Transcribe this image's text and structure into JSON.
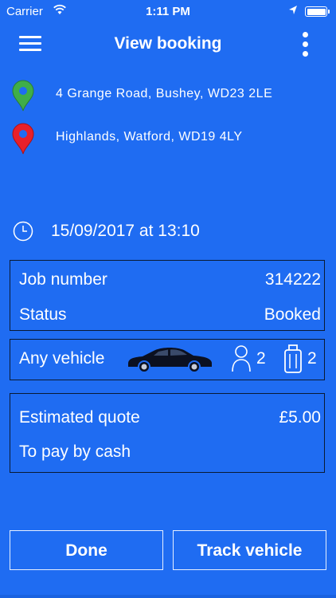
{
  "status_bar": {
    "carrier": "Carrier",
    "time": "1:11 PM",
    "wifi_icon": "wifi-icon",
    "location_icon": "location-arrow-icon",
    "battery_icon": "battery-icon"
  },
  "nav": {
    "title": "View booking",
    "menu_icon": "hamburger-menu-icon",
    "more_icon": "more-vertical-icon"
  },
  "pickup": {
    "address": "4 Grange Road, Bushey, WD23 2LE",
    "icon": "pickup-pin-icon",
    "color": "#3fae49"
  },
  "dropoff": {
    "address": "Highlands, Watford, WD19 4LY",
    "icon": "dropoff-pin-icon",
    "color": "#e8202a"
  },
  "datetime": {
    "text": "15/09/2017 at 13:10",
    "icon": "clock-icon"
  },
  "job": {
    "number_label": "Job number",
    "number_value": "314222",
    "status_label": "Status",
    "status_value": "Booked"
  },
  "vehicle": {
    "label": "Any vehicle",
    "car_icon": "car-icon",
    "passengers": "2",
    "passenger_icon": "person-icon",
    "luggage": "2",
    "luggage_icon": "luggage-icon"
  },
  "quote": {
    "label": "Estimated quote",
    "value": "£5.00",
    "payment": "To pay by cash"
  },
  "buttons": {
    "done": "Done",
    "track": "Track vehicle"
  },
  "colors": {
    "background": "#1f6cf2",
    "border": "#0a1a33",
    "text": "#ffffff"
  }
}
